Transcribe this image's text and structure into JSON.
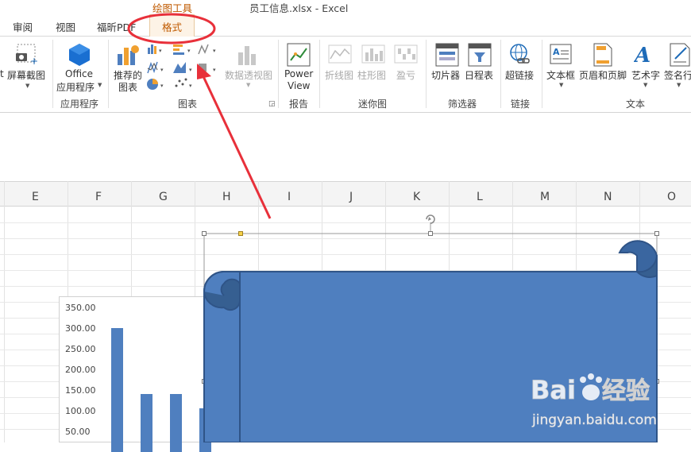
{
  "title_bar": {
    "app_title": "员工信息.xlsx - Excel",
    "context_tool_label": "绘图工具"
  },
  "tabs": [
    {
      "label": "审阅"
    },
    {
      "label": "视图"
    },
    {
      "label": "福昕PDF"
    },
    {
      "label": "格式"
    }
  ],
  "ribbon": {
    "screenshot": {
      "partial_label": "t",
      "label": "屏幕截图"
    },
    "office_apps": {
      "label_line1": "Office",
      "label_line2": "应用程序"
    },
    "recommended_charts": {
      "label_line1": "推荐的",
      "label_line2": "图表"
    },
    "pivot_chart": {
      "label": "数据透视图"
    },
    "power_view": {
      "label_line1": "Power",
      "label_line2": "View"
    },
    "sparkline_line": {
      "label": "折线图"
    },
    "sparkline_column": {
      "label": "柱形图"
    },
    "sparkline_winloss": {
      "label": "盈亏"
    },
    "slicer": {
      "label": "切片器"
    },
    "timeline": {
      "label": "日程表"
    },
    "hyperlink": {
      "label": "超链接"
    },
    "textbox": {
      "label": "文本框"
    },
    "header_footer": {
      "label": "页眉和页脚"
    },
    "wordart": {
      "label": "艺术字"
    },
    "signature": {
      "label": "签名行"
    },
    "groups": {
      "apps": "应用程序",
      "charts": "图表",
      "reports": "报告",
      "sparklines": "迷你图",
      "filters": "筛选器",
      "links": "链接",
      "text": "文本"
    }
  },
  "columns": [
    "E",
    "F",
    "G",
    "H",
    "I",
    "J",
    "K",
    "L",
    "M",
    "N",
    "O"
  ],
  "chart_data": {
    "type": "bar",
    "title": "",
    "y_tick_labels": [
      "350.00",
      "300.00",
      "250.00",
      "200.00",
      "150.00",
      "100.00",
      "50.00"
    ],
    "values": [
      300,
      140,
      140,
      105
    ],
    "ylim": [
      0,
      350
    ]
  },
  "colors": {
    "accent_orange": "#c05a00",
    "shape_fill": "#4f7fbf",
    "shape_stroke": "#2f5487",
    "annotation_red": "#e8303a"
  },
  "watermark": {
    "brand": "Bai",
    "brand_tail": "du",
    "cn": "经验",
    "url": "jingyan.baidu.com"
  }
}
